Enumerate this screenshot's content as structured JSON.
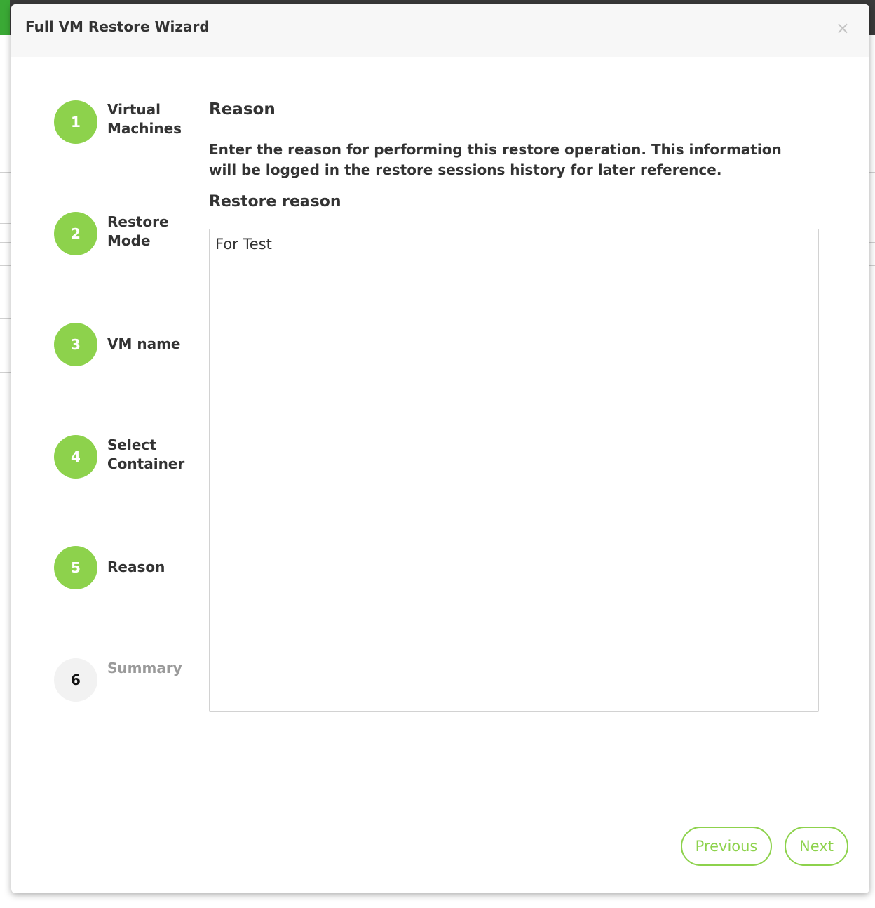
{
  "wizard": {
    "title": "Full VM Restore Wizard",
    "close_icon": "close-icon",
    "close_glyph": "×"
  },
  "steps": [
    {
      "number": "1",
      "label": "Virtual Machines",
      "state": "completed"
    },
    {
      "number": "2",
      "label": "Restore Mode",
      "state": "completed"
    },
    {
      "number": "3",
      "label": "VM name",
      "state": "completed"
    },
    {
      "number": "4",
      "label": "Select Container",
      "state": "completed"
    },
    {
      "number": "5",
      "label": "Reason",
      "state": "current"
    },
    {
      "number": "6",
      "label": "Summary",
      "state": "pending"
    }
  ],
  "main": {
    "section_title": "Reason",
    "description": "Enter the reason for performing this restore operation. This information will be logged in the restore sessions history for later reference.",
    "field_label": "Restore reason",
    "reason_value": "For Test"
  },
  "footer": {
    "previous_label": "Previous",
    "next_label": "Next"
  },
  "colors": {
    "accent": "#8dd24c",
    "header_bg": "#f7f7f7",
    "inactive_step_bg": "#f2f2f2"
  }
}
